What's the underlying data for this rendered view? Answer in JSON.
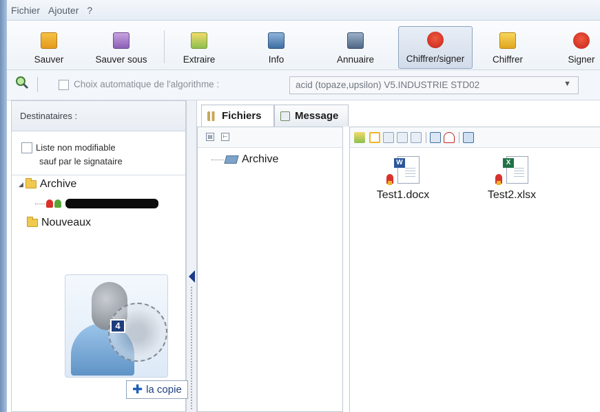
{
  "menu": {
    "items": [
      "Fichier",
      "Ajouter",
      "?"
    ]
  },
  "toolbar": {
    "buttons": [
      {
        "label": "Sauver",
        "icon": "floppy-disk-icon"
      },
      {
        "label": "Sauver sous",
        "icon": "floppy-disk-question-icon"
      },
      {
        "label": "Extraire",
        "icon": "extract-folder-icon"
      },
      {
        "label": "Info",
        "icon": "info-icon"
      },
      {
        "label": "Annuaire",
        "icon": "directory-icon"
      },
      {
        "label": "Chiffrer/signer",
        "icon": "ribbon-lock-icon",
        "active": true
      },
      {
        "label": "Chiffrer",
        "icon": "padlock-icon"
      },
      {
        "label": "Signer",
        "icon": "ribbon-icon"
      }
    ]
  },
  "algo": {
    "checkbox_label": "Choix automatique de l'algorithme :",
    "selected_value": "acid (topaze,upsilon) V5.INDUSTRIE STD02"
  },
  "recipients": {
    "header": "Destinataires :",
    "lock_label_line1": "Liste non modifiable",
    "lock_label_line2": "sauf par le signataire",
    "tree": [
      {
        "label": "Archive"
      },
      {
        "label": "Nouveaux"
      }
    ]
  },
  "tabs": [
    {
      "label": "Fichiers",
      "active": true
    },
    {
      "label": "Message",
      "active": false
    }
  ],
  "folder_tree": {
    "root": "Archive"
  },
  "files": [
    {
      "name": "Test1.docx",
      "type": "word",
      "badge": "W"
    },
    {
      "name": "Test2.xlsx",
      "type": "excel",
      "badge": "X"
    }
  ],
  "drag": {
    "count": "4",
    "tooltip": "la copie"
  },
  "colors": {
    "accent": "#1f3c7d",
    "word": "#2b579a",
    "excel": "#217346",
    "ribbon": "#d8322a"
  }
}
